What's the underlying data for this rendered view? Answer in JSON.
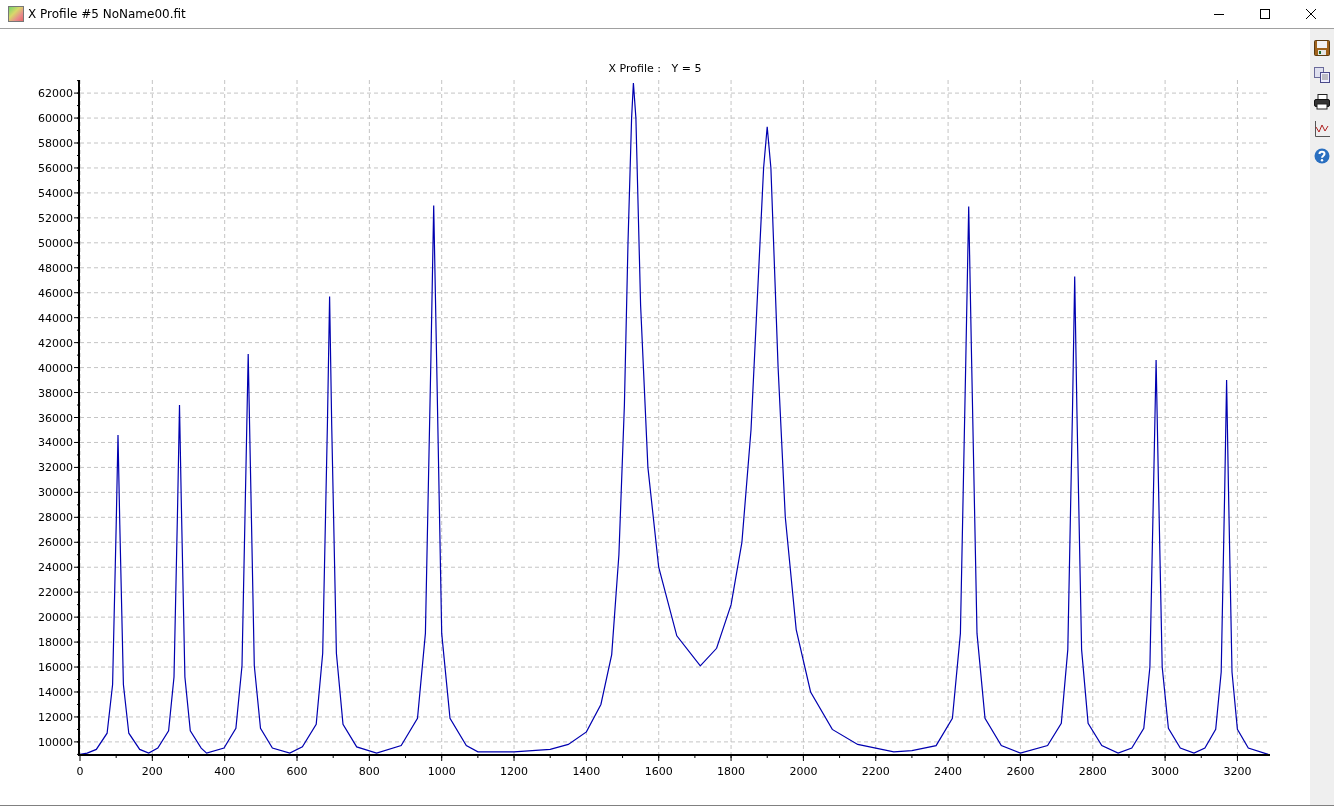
{
  "window": {
    "title": "X Profile #5 NoName00.fit"
  },
  "plot": {
    "chart_data": {
      "type": "line",
      "title": "X Profile :   Y = 5",
      "xlim": [
        0,
        3290
      ],
      "ylim": [
        8950,
        63050
      ],
      "xticks": [
        0,
        200,
        400,
        600,
        800,
        1000,
        1200,
        1400,
        1600,
        1800,
        2000,
        2200,
        2400,
        2600,
        2800,
        3000,
        3200
      ],
      "yticks": [
        10000,
        12000,
        14000,
        16000,
        18000,
        20000,
        22000,
        24000,
        26000,
        28000,
        30000,
        32000,
        34000,
        36000,
        38000,
        40000,
        42000,
        44000,
        46000,
        48000,
        50000,
        52000,
        54000,
        56000,
        58000,
        60000,
        62000
      ],
      "x": [
        0,
        20,
        45,
        75,
        90,
        100,
        105,
        110,
        120,
        135,
        165,
        190,
        215,
        245,
        260,
        270,
        275,
        280,
        290,
        305,
        335,
        350,
        398,
        431,
        448,
        459,
        465,
        471,
        482,
        499,
        532,
        580,
        615,
        653,
        671,
        684,
        690,
        696,
        709,
        727,
        765,
        820,
        888,
        933,
        955,
        970,
        978,
        986,
        1000,
        1023,
        1068,
        1100,
        1200,
        1300,
        1350,
        1400,
        1440,
        1470,
        1490,
        1505,
        1515,
        1525,
        1530,
        1537,
        1550,
        1570,
        1600,
        1650,
        1715,
        1760,
        1800,
        1830,
        1855,
        1875,
        1890,
        1900,
        1910,
        1930,
        1950,
        1980,
        2020,
        2080,
        2150,
        2250,
        2300,
        2367,
        2412,
        2434,
        2449,
        2457,
        2465,
        2480,
        2502,
        2547,
        2600,
        2675,
        2713,
        2731,
        2744,
        2750,
        2756,
        2769,
        2787,
        2825,
        2870,
        2908,
        2941,
        2958,
        2969,
        2975,
        2981,
        2992,
        3009,
        3042,
        3080,
        3110,
        3140,
        3155,
        3165,
        3170,
        3175,
        3185,
        3200,
        3230,
        3285
      ],
      "grid": true,
      "series": [
        {
          "color": "#0000b0",
          "values": [
            9000,
            9100,
            9400,
            10700,
            14600,
            27400,
            34600,
            27400,
            14600,
            10700,
            9400,
            9100,
            9500,
            10900,
            15200,
            29200,
            37000,
            29200,
            15200,
            10900,
            9500,
            9100,
            9500,
            11100,
            16100,
            32100,
            41100,
            32100,
            16100,
            11100,
            9500,
            9100,
            9600,
            11400,
            17100,
            35400,
            45700,
            35400,
            17100,
            11400,
            9600,
            9100,
            9700,
            11900,
            18700,
            40700,
            53000,
            40700,
            18700,
            11900,
            9700,
            9200,
            9200,
            9400,
            9800,
            10800,
            13000,
            17000,
            25000,
            37000,
            50000,
            60000,
            62800,
            60000,
            45000,
            32000,
            24000,
            18500,
            16100,
            17500,
            21000,
            26000,
            35000,
            47000,
            56000,
            59300,
            56000,
            40000,
            28000,
            19000,
            14000,
            11000,
            9800,
            9200,
            9300,
            9700,
            11900,
            18700,
            40600,
            52900,
            40600,
            18700,
            11900,
            9700,
            9100,
            9700,
            11500,
            17400,
            36600,
            47300,
            36600,
            17400,
            11500,
            9700,
            9100,
            9500,
            11100,
            16000,
            31800,
            40600,
            31800,
            16000,
            11100,
            9500,
            9100,
            9500,
            11000,
            15600,
            30600,
            39000,
            30600,
            15600,
            11000,
            9500,
            9000
          ]
        }
      ]
    }
  },
  "toolbar": [
    {
      "kind": "save"
    },
    {
      "kind": "copy"
    },
    {
      "kind": "print"
    },
    {
      "kind": "chart"
    },
    {
      "kind": "help"
    }
  ]
}
